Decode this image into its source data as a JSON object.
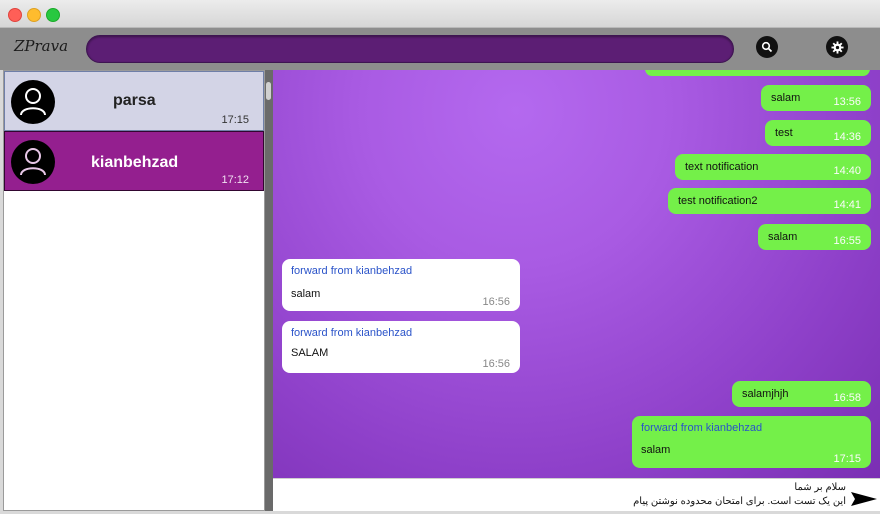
{
  "app": {
    "title": "ZPrava"
  },
  "header": {
    "search_placeholder": ""
  },
  "chats": [
    {
      "name": "parsa",
      "time": "17:15",
      "selected": false
    },
    {
      "name": "kianbehzad",
      "time": "17:12",
      "selected": true
    }
  ],
  "messages": [
    {
      "type": "out",
      "text": "salam",
      "time": "13:56"
    },
    {
      "type": "out",
      "text": "test",
      "time": "14:36"
    },
    {
      "type": "out",
      "text": "text notification",
      "time": "14:40"
    },
    {
      "type": "out",
      "text": "test notification2",
      "time": "14:41"
    },
    {
      "type": "out",
      "text": "salam",
      "time": "16:55"
    },
    {
      "type": "in",
      "forward": "forward from kianbehzad",
      "text": "salam",
      "time": "16:56"
    },
    {
      "type": "in",
      "forward": "forward from kianbehzad",
      "text": "SALAM",
      "time": "16:56"
    },
    {
      "type": "out",
      "text": "salamjhjh",
      "time": "16:58"
    },
    {
      "type": "out",
      "forward": "forward from kianbehzad",
      "text": "salam",
      "time": "17:15"
    }
  ],
  "composer": {
    "line1": "سلام بر شما",
    "line2": "این یک تست است. برای امتحان محدوده نوشتن پیام"
  },
  "colors": {
    "accent": "#5c1e74",
    "selected_chat": "#941f8f",
    "outgoing_bubble": "#74f049",
    "incoming_bubble": "#ffffff",
    "forward_text": "#2a53c9"
  },
  "icons": {
    "search": "search-icon",
    "settings": "gear-icon",
    "avatar": "user-icon",
    "send": "send-icon"
  }
}
